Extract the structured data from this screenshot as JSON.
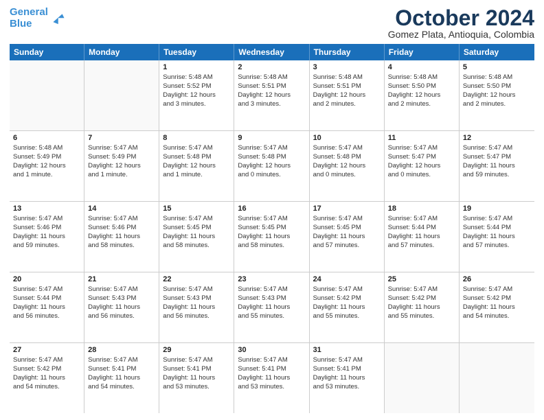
{
  "logo": {
    "line1": "General",
    "line2": "Blue",
    "arrow_color": "#3a8fd4"
  },
  "header": {
    "month": "October 2024",
    "location": "Gomez Plata, Antioquia, Colombia"
  },
  "weekdays": [
    "Sunday",
    "Monday",
    "Tuesday",
    "Wednesday",
    "Thursday",
    "Friday",
    "Saturday"
  ],
  "rows": [
    [
      {
        "day": "",
        "text": ""
      },
      {
        "day": "",
        "text": ""
      },
      {
        "day": "1",
        "text": "Sunrise: 5:48 AM\nSunset: 5:52 PM\nDaylight: 12 hours\nand 3 minutes."
      },
      {
        "day": "2",
        "text": "Sunrise: 5:48 AM\nSunset: 5:51 PM\nDaylight: 12 hours\nand 3 minutes."
      },
      {
        "day": "3",
        "text": "Sunrise: 5:48 AM\nSunset: 5:51 PM\nDaylight: 12 hours\nand 2 minutes."
      },
      {
        "day": "4",
        "text": "Sunrise: 5:48 AM\nSunset: 5:50 PM\nDaylight: 12 hours\nand 2 minutes."
      },
      {
        "day": "5",
        "text": "Sunrise: 5:48 AM\nSunset: 5:50 PM\nDaylight: 12 hours\nand 2 minutes."
      }
    ],
    [
      {
        "day": "6",
        "text": "Sunrise: 5:48 AM\nSunset: 5:49 PM\nDaylight: 12 hours\nand 1 minute."
      },
      {
        "day": "7",
        "text": "Sunrise: 5:47 AM\nSunset: 5:49 PM\nDaylight: 12 hours\nand 1 minute."
      },
      {
        "day": "8",
        "text": "Sunrise: 5:47 AM\nSunset: 5:48 PM\nDaylight: 12 hours\nand 1 minute."
      },
      {
        "day": "9",
        "text": "Sunrise: 5:47 AM\nSunset: 5:48 PM\nDaylight: 12 hours\nand 0 minutes."
      },
      {
        "day": "10",
        "text": "Sunrise: 5:47 AM\nSunset: 5:48 PM\nDaylight: 12 hours\nand 0 minutes."
      },
      {
        "day": "11",
        "text": "Sunrise: 5:47 AM\nSunset: 5:47 PM\nDaylight: 12 hours\nand 0 minutes."
      },
      {
        "day": "12",
        "text": "Sunrise: 5:47 AM\nSunset: 5:47 PM\nDaylight: 11 hours\nand 59 minutes."
      }
    ],
    [
      {
        "day": "13",
        "text": "Sunrise: 5:47 AM\nSunset: 5:46 PM\nDaylight: 11 hours\nand 59 minutes."
      },
      {
        "day": "14",
        "text": "Sunrise: 5:47 AM\nSunset: 5:46 PM\nDaylight: 11 hours\nand 58 minutes."
      },
      {
        "day": "15",
        "text": "Sunrise: 5:47 AM\nSunset: 5:45 PM\nDaylight: 11 hours\nand 58 minutes."
      },
      {
        "day": "16",
        "text": "Sunrise: 5:47 AM\nSunset: 5:45 PM\nDaylight: 11 hours\nand 58 minutes."
      },
      {
        "day": "17",
        "text": "Sunrise: 5:47 AM\nSunset: 5:45 PM\nDaylight: 11 hours\nand 57 minutes."
      },
      {
        "day": "18",
        "text": "Sunrise: 5:47 AM\nSunset: 5:44 PM\nDaylight: 11 hours\nand 57 minutes."
      },
      {
        "day": "19",
        "text": "Sunrise: 5:47 AM\nSunset: 5:44 PM\nDaylight: 11 hours\nand 57 minutes."
      }
    ],
    [
      {
        "day": "20",
        "text": "Sunrise: 5:47 AM\nSunset: 5:44 PM\nDaylight: 11 hours\nand 56 minutes."
      },
      {
        "day": "21",
        "text": "Sunrise: 5:47 AM\nSunset: 5:43 PM\nDaylight: 11 hours\nand 56 minutes."
      },
      {
        "day": "22",
        "text": "Sunrise: 5:47 AM\nSunset: 5:43 PM\nDaylight: 11 hours\nand 56 minutes."
      },
      {
        "day": "23",
        "text": "Sunrise: 5:47 AM\nSunset: 5:43 PM\nDaylight: 11 hours\nand 55 minutes."
      },
      {
        "day": "24",
        "text": "Sunrise: 5:47 AM\nSunset: 5:42 PM\nDaylight: 11 hours\nand 55 minutes."
      },
      {
        "day": "25",
        "text": "Sunrise: 5:47 AM\nSunset: 5:42 PM\nDaylight: 11 hours\nand 55 minutes."
      },
      {
        "day": "26",
        "text": "Sunrise: 5:47 AM\nSunset: 5:42 PM\nDaylight: 11 hours\nand 54 minutes."
      }
    ],
    [
      {
        "day": "27",
        "text": "Sunrise: 5:47 AM\nSunset: 5:42 PM\nDaylight: 11 hours\nand 54 minutes."
      },
      {
        "day": "28",
        "text": "Sunrise: 5:47 AM\nSunset: 5:41 PM\nDaylight: 11 hours\nand 54 minutes."
      },
      {
        "day": "29",
        "text": "Sunrise: 5:47 AM\nSunset: 5:41 PM\nDaylight: 11 hours\nand 53 minutes."
      },
      {
        "day": "30",
        "text": "Sunrise: 5:47 AM\nSunset: 5:41 PM\nDaylight: 11 hours\nand 53 minutes."
      },
      {
        "day": "31",
        "text": "Sunrise: 5:47 AM\nSunset: 5:41 PM\nDaylight: 11 hours\nand 53 minutes."
      },
      {
        "day": "",
        "text": ""
      },
      {
        "day": "",
        "text": ""
      }
    ]
  ]
}
